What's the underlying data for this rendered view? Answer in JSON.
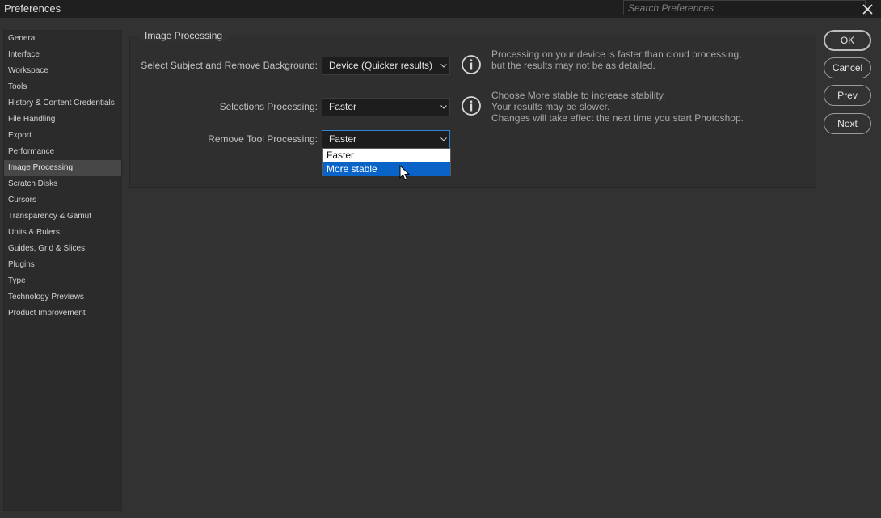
{
  "window": {
    "title": "Preferences"
  },
  "search": {
    "placeholder": "Search Preferences"
  },
  "sidebar": {
    "items": [
      {
        "label": "General"
      },
      {
        "label": "Interface"
      },
      {
        "label": "Workspace"
      },
      {
        "label": "Tools"
      },
      {
        "label": "History & Content Credentials"
      },
      {
        "label": "File Handling"
      },
      {
        "label": "Export"
      },
      {
        "label": "Performance"
      },
      {
        "label": "Image Processing"
      },
      {
        "label": "Scratch Disks"
      },
      {
        "label": "Cursors"
      },
      {
        "label": "Transparency & Gamut"
      },
      {
        "label": "Units & Rulers"
      },
      {
        "label": "Guides, Grid & Slices"
      },
      {
        "label": "Plugins"
      },
      {
        "label": "Type"
      },
      {
        "label": "Technology Previews"
      },
      {
        "label": "Product Improvement"
      }
    ],
    "selected": "Image Processing"
  },
  "panel": {
    "group_title": "Image Processing",
    "select_subject": {
      "label": "Select Subject and Remove Background:",
      "value": "Device (Quicker results)",
      "desc_line1": "Processing on your device is faster than cloud processing,",
      "desc_line2": "but the results may not be as detailed."
    },
    "selections": {
      "label": "Selections Processing:",
      "value": "Faster",
      "desc_line1": "Choose More stable to increase stability.",
      "desc_line2": "Your results may be slower.",
      "desc_line3": "Changes will take effect the next time you start Photoshop."
    },
    "remove_tool": {
      "label": "Remove Tool Processing:",
      "value": "Faster",
      "options": [
        "Faster",
        "More stable"
      ],
      "highlighted": "More stable"
    }
  },
  "buttons": {
    "ok": "OK",
    "cancel": "Cancel",
    "prev": "Prev",
    "next": "Next"
  },
  "colors": {
    "highlight": "#0a64c8",
    "focus_border": "#2f86d6",
    "background": "#323232"
  }
}
